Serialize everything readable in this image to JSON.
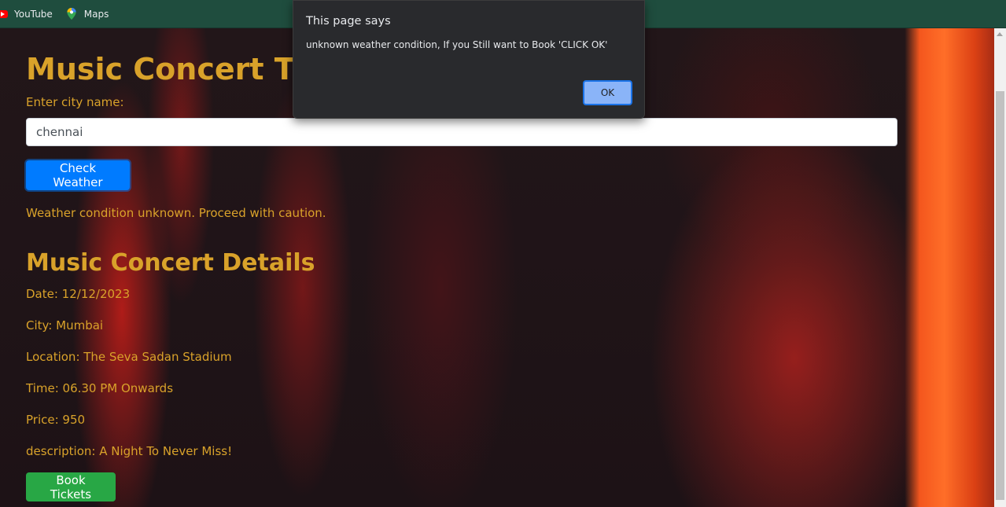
{
  "bookmarks": [
    {
      "label": "YouTube",
      "icon": "youtube-icon"
    },
    {
      "label": "Maps",
      "icon": "maps-icon"
    }
  ],
  "page": {
    "heading": "Music Concert Tickets",
    "city_label": "Enter city name:",
    "city_input_value": "chennai",
    "check_button": "Check Weather",
    "status": "Weather condition unknown. Proceed with caution.",
    "details_heading": "Music Concert Details",
    "details": [
      "Date: 12/12/2023",
      "City: Mumbai",
      "Location: The Seva Sadan Stadium",
      "Time: 06.30 PM Onwards",
      "Price: 950",
      "description: A Night To Never Miss!"
    ],
    "book_button": "Book Tickets"
  },
  "dialog": {
    "title": "This page says",
    "message": "unknown weather condition,  If you Still want to Book 'CLICK OK'",
    "ok_label": "OK"
  },
  "colors": {
    "accent_text": "#d9a22a",
    "primary_button": "#007bff",
    "success_button": "#28a745",
    "bookmarks_bar": "#1f4d3e",
    "dialog_bg": "#292a2d"
  }
}
